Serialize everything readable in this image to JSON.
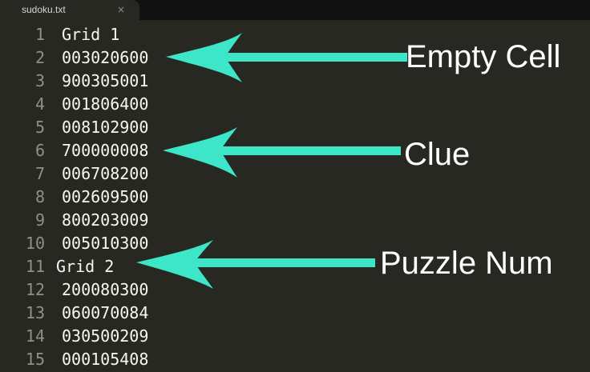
{
  "tab": {
    "title": "sudoku.txt",
    "close_glyph": "×"
  },
  "lines": [
    {
      "number": "1",
      "text": "Grid 1"
    },
    {
      "number": "2",
      "text": "003020600"
    },
    {
      "number": "3",
      "text": "900305001"
    },
    {
      "number": "4",
      "text": "001806400"
    },
    {
      "number": "5",
      "text": "008102900"
    },
    {
      "number": "6",
      "text": "700000008"
    },
    {
      "number": "7",
      "text": "006708200"
    },
    {
      "number": "8",
      "text": "002609500"
    },
    {
      "number": "9",
      "text": "800203009"
    },
    {
      "number": "10",
      "text": "005010300"
    },
    {
      "number": "11",
      "text": "Grid 2"
    },
    {
      "number": "12",
      "text": "200080300"
    },
    {
      "number": "13",
      "text": "060070084"
    },
    {
      "number": "14",
      "text": "030500209"
    },
    {
      "number": "15",
      "text": "000105408"
    }
  ],
  "annotations": {
    "empty_cell": "Empty Cell",
    "clue": "Clue",
    "puzzle_num": "Puzzle Num"
  },
  "colors": {
    "editor_bg": "#272822",
    "tabbar_bg": "#111111",
    "text": "#f8f8f2",
    "gutter": "#8f908a",
    "arrow": "#3ee6c9"
  }
}
